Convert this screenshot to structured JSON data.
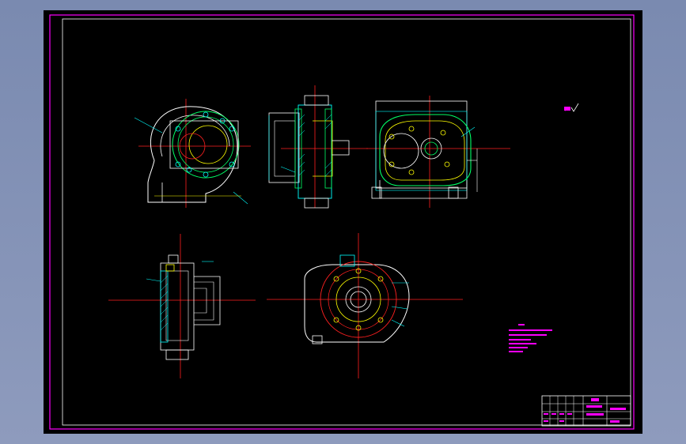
{
  "window": {
    "background_color": "#8e9bbd",
    "canvas_color": "#000000"
  },
  "drawing": {
    "frame_color": "#ff00ff",
    "centerline_color": "#ff2020",
    "outline_color": "#ffffff",
    "detail_colors": [
      "#00ff66",
      "#00ffff",
      "#ffff00"
    ]
  }
}
